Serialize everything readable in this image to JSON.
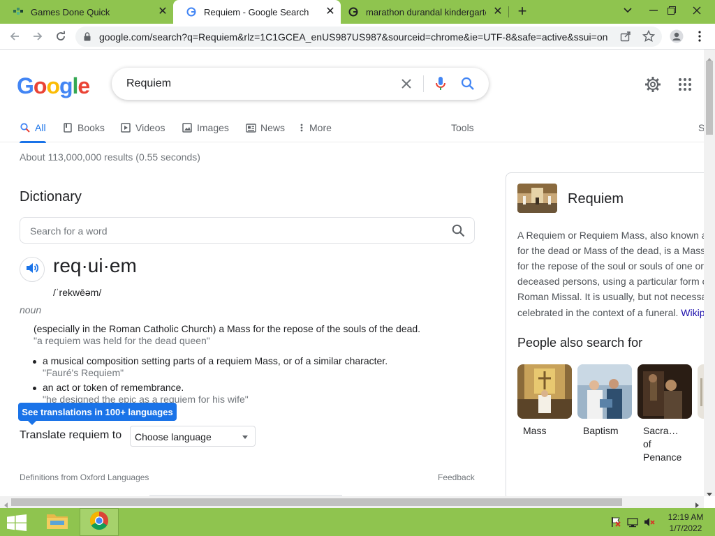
{
  "browser": {
    "tabs": [
      {
        "title": "Games Done Quick",
        "active": false
      },
      {
        "title": "Requiem - Google Search",
        "active": true
      },
      {
        "title": "marathon durandal kindergarten",
        "active": false
      }
    ],
    "url": "google.com/search?q=Requiem&rlz=1C1GCEA_enUS987US987&sourceid=chrome&ie=UTF-8&safe=active&ssui=on"
  },
  "google": {
    "logo": [
      "G",
      "o",
      "o",
      "g",
      "l",
      "e"
    ],
    "logo_colors": [
      "#4285f4",
      "#ea4335",
      "#fbbc05",
      "#4285f4",
      "#34a853",
      "#ea4335"
    ],
    "query": "Requiem",
    "nav_tabs": [
      "All",
      "Books",
      "Videos",
      "Images",
      "News",
      "More"
    ],
    "tools_label": "Tools",
    "cut_label": "S",
    "result_stats": "About 113,000,000 results (0.55 seconds)"
  },
  "dictionary": {
    "title": "Dictionary",
    "search_placeholder": "Search for a word",
    "headword": "req·ui·em",
    "pronunciation": "/ˈrekwēəm/",
    "part_of_speech": "noun",
    "definitions": [
      {
        "text": "(especially in the Roman Catholic Church) a Mass for the repose of the souls of the dead.",
        "example": "\"a requiem was held for the dead queen\""
      },
      {
        "text": "a musical composition setting parts of a requiem Mass, or of a similar character.",
        "example": "\"Fauré's Requiem\""
      },
      {
        "text": "an act or token of remembrance.",
        "example": "\"he designed the epic as a requiem for his wife\""
      }
    ],
    "translations_tooltip": "See translations in 100+ languages",
    "translate_label": "Translate requiem to",
    "translate_select": "Choose language",
    "source": "Definitions from Oxford Languages",
    "feedback": "Feedback"
  },
  "knowledge_panel": {
    "title": "Requiem",
    "description_lines": [
      "A Requiem or Requiem Mass, also known a",
      "for the dead or Mass of the dead, is a Mass",
      "for the repose of the soul or souls of one or",
      "deceased persons, using a particular form o",
      "Roman Missal. It is usually, but not necessa",
      "celebrated in the context of a funeral. "
    ],
    "description_link": "Wikip",
    "people_also_search_title": "People also search for",
    "people_also_search": [
      {
        "label_lines": [
          "Mass"
        ]
      },
      {
        "label_lines": [
          "Baptism"
        ]
      },
      {
        "label_lines": [
          "Sacra…",
          "of",
          "Penance"
        ]
      }
    ]
  },
  "taskbar": {
    "time": "12:19 AM",
    "date": "1/7/2022"
  }
}
